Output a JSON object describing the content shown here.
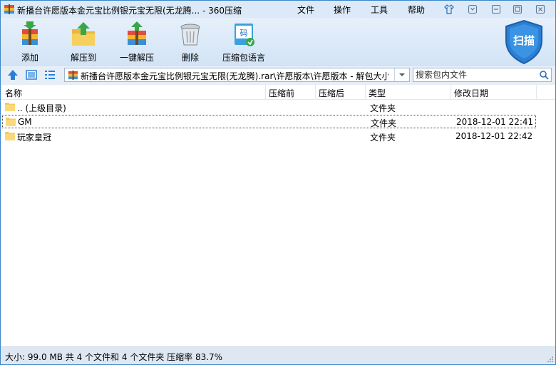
{
  "window": {
    "title": "新播台许愿版本金元宝比例银元宝无限(无龙腾... - 360压缩",
    "menus": [
      "文件",
      "操作",
      "工具",
      "帮助"
    ]
  },
  "toolbar": {
    "items": [
      {
        "label": "添加",
        "icon": "add-archive-icon"
      },
      {
        "label": "解压到",
        "icon": "extract-to-icon"
      },
      {
        "label": "一键解压",
        "icon": "one-click-extract-icon"
      },
      {
        "label": "删除",
        "icon": "delete-trash-icon"
      },
      {
        "label": "压缩包语言",
        "icon": "archive-language-icon"
      }
    ],
    "scan_label": "扫描"
  },
  "address": {
    "path": "新播台许愿版本金元宝比例银元宝无限(无龙腾).rar\\许愿版本\\许愿版本 - 解包大小:",
    "search_placeholder": "搜索包内文件"
  },
  "columns": [
    "名称",
    "压缩前",
    "压缩后",
    "类型",
    "修改日期"
  ],
  "rows": [
    {
      "name": ".. (上级目录)",
      "type": "文件夹",
      "date": ""
    },
    {
      "name": "GM",
      "type": "文件夹",
      "date": "2018-12-01 22:41"
    },
    {
      "name": "玩家皇冠",
      "type": "文件夹",
      "date": "2018-12-01 22:42"
    }
  ],
  "status": "大小: 99.0 MB 共 4 个文件和 4 个文件夹 压缩率 83.7%",
  "colors": {
    "accent": "#2a7fd4",
    "folder": "#f4cc5a",
    "titlebar": "#dbe9f8",
    "statusbar": "#dfe8f2"
  }
}
